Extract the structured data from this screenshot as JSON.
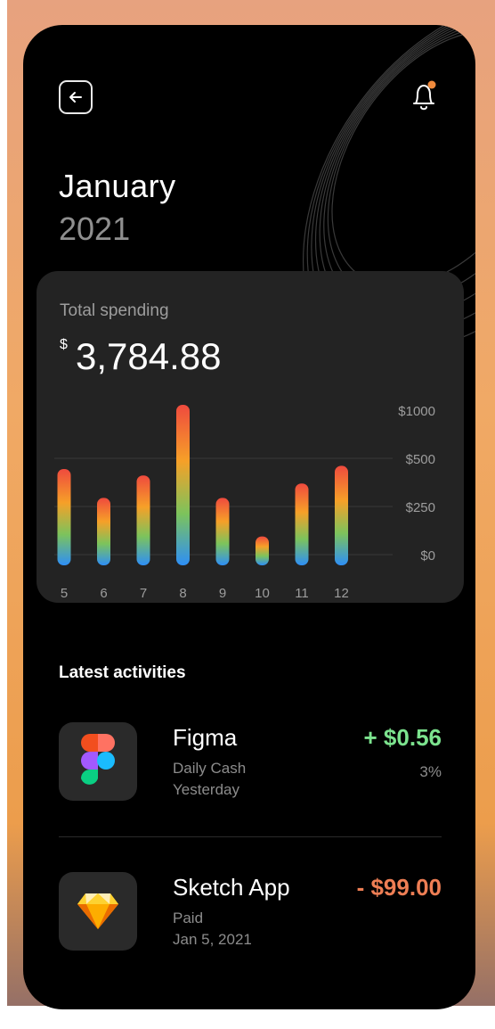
{
  "header": {
    "back_icon": "arrow-left-icon",
    "notification_icon": "bell-icon",
    "notification_dot_color": "#f08a3c"
  },
  "period": {
    "month": "January",
    "year": "2021"
  },
  "summary": {
    "label": "Total spending",
    "currency_symbol": "$",
    "amount": "3,784.88"
  },
  "chart_data": {
    "type": "bar",
    "categories": [
      "5",
      "6",
      "7",
      "8",
      "9",
      "10",
      "11",
      "12"
    ],
    "values": [
      600,
      420,
      560,
      1000,
      420,
      180,
      510,
      620
    ],
    "y_tick_labels": [
      "$1000",
      "$500",
      "$250",
      "$0"
    ],
    "gradient_colors": [
      "#ef4a3e",
      "#f6a028",
      "#7cc35c",
      "#2e8ff6"
    ],
    "grid": true,
    "title": "",
    "xlabel": "",
    "ylabel": ""
  },
  "activities": {
    "title": "Latest activities",
    "items": [
      {
        "name": "Figma",
        "line1": "Daily Cash",
        "line2": "Yesterday",
        "amount": "+ $0.56",
        "percent": "3%",
        "icon": "figma-logo-icon",
        "sign": "positive",
        "color": "#7ce38e"
      },
      {
        "name": "Sketch App",
        "line1": "Paid",
        "line2": "Jan 5, 2021",
        "amount": "- $99.00",
        "percent": "",
        "icon": "sketch-logo-icon",
        "sign": "negative",
        "color": "#ee7e54"
      }
    ]
  }
}
